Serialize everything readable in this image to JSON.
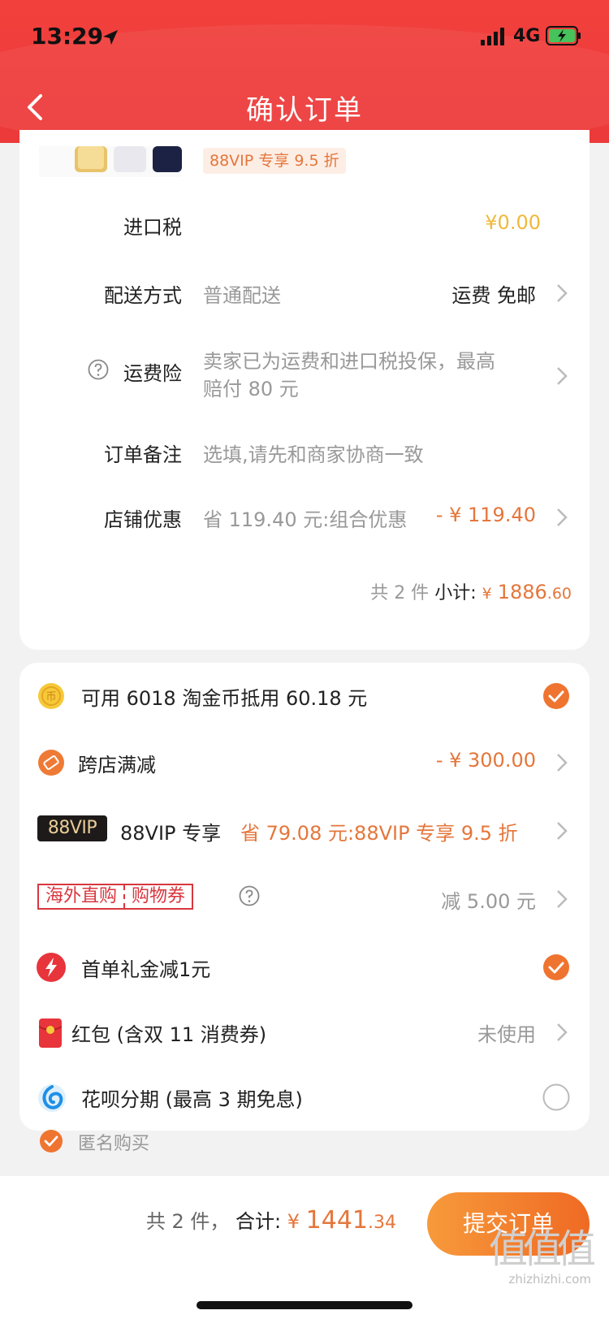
{
  "status_bar": {
    "time": "13:29",
    "network": "4G"
  },
  "nav": {
    "title": "确认订单"
  },
  "product": {
    "vip_tag": "88VIP 专享 9.5 折"
  },
  "order_rows": {
    "tax": {
      "label": "进口税",
      "value": "¥0.00"
    },
    "delivery": {
      "label": "配送方式",
      "desc": "普通配送",
      "value": "运费 免邮"
    },
    "insurance": {
      "label": "运费险",
      "desc_line1": "卖家已为运费和进口税投保，最高",
      "desc_line2": "赔付 80 元"
    },
    "note": {
      "label": "订单备注",
      "placeholder": "选填,请先和商家协商一致"
    },
    "shop_discount": {
      "label": "店铺优惠",
      "desc": "省 119.40 元:组合优惠",
      "value": "- ¥ 119.40"
    }
  },
  "subtotal": {
    "count": "共 2 件",
    "label": "小计:",
    "currency": "¥",
    "amount": "1886",
    "decimal": ".60"
  },
  "discounts": {
    "coins": {
      "label": "可用 6018 淘金币抵用 60.18 元",
      "checked": true
    },
    "cross_store": {
      "label": "跨店满减",
      "value": "- ¥ 300.00"
    },
    "vip": {
      "badge": "88VIP",
      "label": "88VIP 专享",
      "value": "省 79.08 元:88VIP 专享 9.5 折"
    },
    "overseas": {
      "badge_left": "海外直购",
      "badge_right": "购物券",
      "value": "减 5.00 元"
    },
    "first_order": {
      "label": "首单礼金减1元",
      "checked": true
    },
    "red_packet": {
      "label": "红包 (含双 11 消费券)",
      "value": "未使用"
    },
    "huabei": {
      "label": "花呗分期 (最高 3 期免息)",
      "checked": false
    }
  },
  "anonymous": {
    "label": "匿名购买",
    "checked": true
  },
  "footer": {
    "count": "共 2 件，",
    "total_label": "合计:",
    "currency": "¥",
    "amount": "1441",
    "decimal": ".34",
    "submit_label": "提交订单"
  },
  "watermark": {
    "logo": "值值值",
    "text": "zhizhizhi.com"
  },
  "colors": {
    "header_red": "#ee3b3b",
    "accent_orange": "#e5763b",
    "button_gradient_start": "#f79a3b",
    "button_gradient_end": "#ef6a24"
  }
}
